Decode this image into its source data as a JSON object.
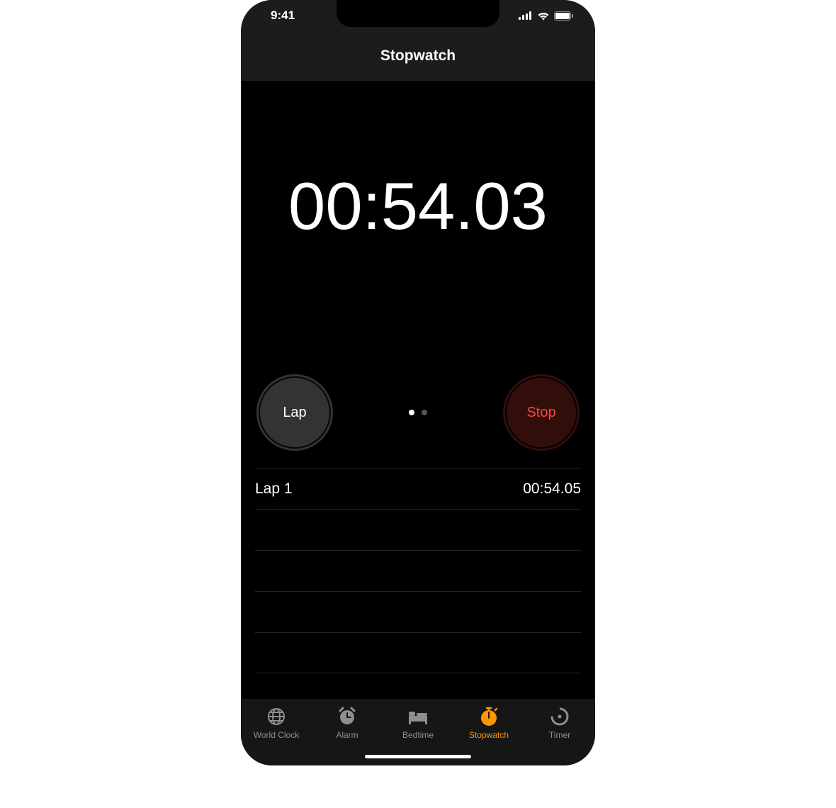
{
  "statusBar": {
    "time": "9:41"
  },
  "nav": {
    "title": "Stopwatch"
  },
  "timer": {
    "display": "00:54.03"
  },
  "controls": {
    "lap_label": "Lap",
    "stop_label": "Stop"
  },
  "laps": [
    {
      "label": "Lap 1",
      "time": "00:54.05"
    }
  ],
  "tabs": {
    "world_clock": "World Clock",
    "alarm": "Alarm",
    "bedtime": "Bedtime",
    "stopwatch": "Stopwatch",
    "timer": "Timer"
  },
  "colors": {
    "accent": "#ff9500",
    "stop": "#ff453a"
  }
}
